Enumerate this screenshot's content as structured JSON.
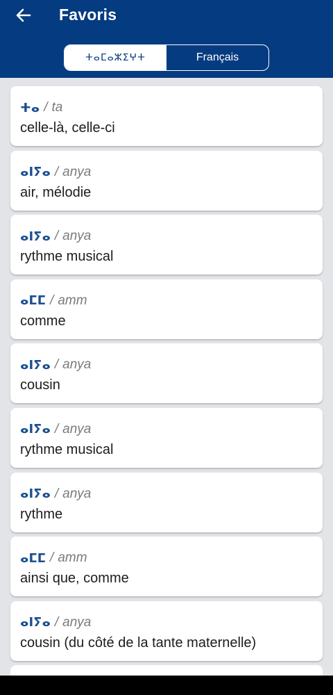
{
  "header": {
    "title": "Favoris",
    "back_icon": "arrow-left-icon",
    "bg_color": "#053b80"
  },
  "toggle": {
    "option_tifinagh": "ⵜⴰⵎⴰⵣⵉⵖⵜ",
    "option_french": "Français",
    "selected": "ⵜⴰⵎⴰⵣⵉⵖⵜ"
  },
  "entries": [
    {
      "tifinagh": "ⵜⴰ",
      "latin": "ta",
      "meaning": "celle-là, celle-ci"
    },
    {
      "tifinagh": "ⴰⵏⵢⴰ",
      "latin": "anya",
      "meaning": "air, mélodie"
    },
    {
      "tifinagh": "ⴰⵏⵢⴰ",
      "latin": "anya",
      "meaning": "rythme musical"
    },
    {
      "tifinagh": "ⴰⵎⵎ",
      "latin": "amm",
      "meaning": "comme"
    },
    {
      "tifinagh": "ⴰⵏⵢⴰ",
      "latin": "anya",
      "meaning": "cousin"
    },
    {
      "tifinagh": "ⴰⵏⵢⴰ",
      "latin": "anya",
      "meaning": "rythme musical"
    },
    {
      "tifinagh": "ⴰⵏⵢⴰ",
      "latin": "anya",
      "meaning": "rythme"
    },
    {
      "tifinagh": "ⴰⵎⵎ",
      "latin": "amm",
      "meaning": "ainsi que, comme"
    },
    {
      "tifinagh": "ⴰⵏⵢⴰ",
      "latin": "anya",
      "meaning": "cousin (du côté de la tante maternelle)"
    }
  ]
}
